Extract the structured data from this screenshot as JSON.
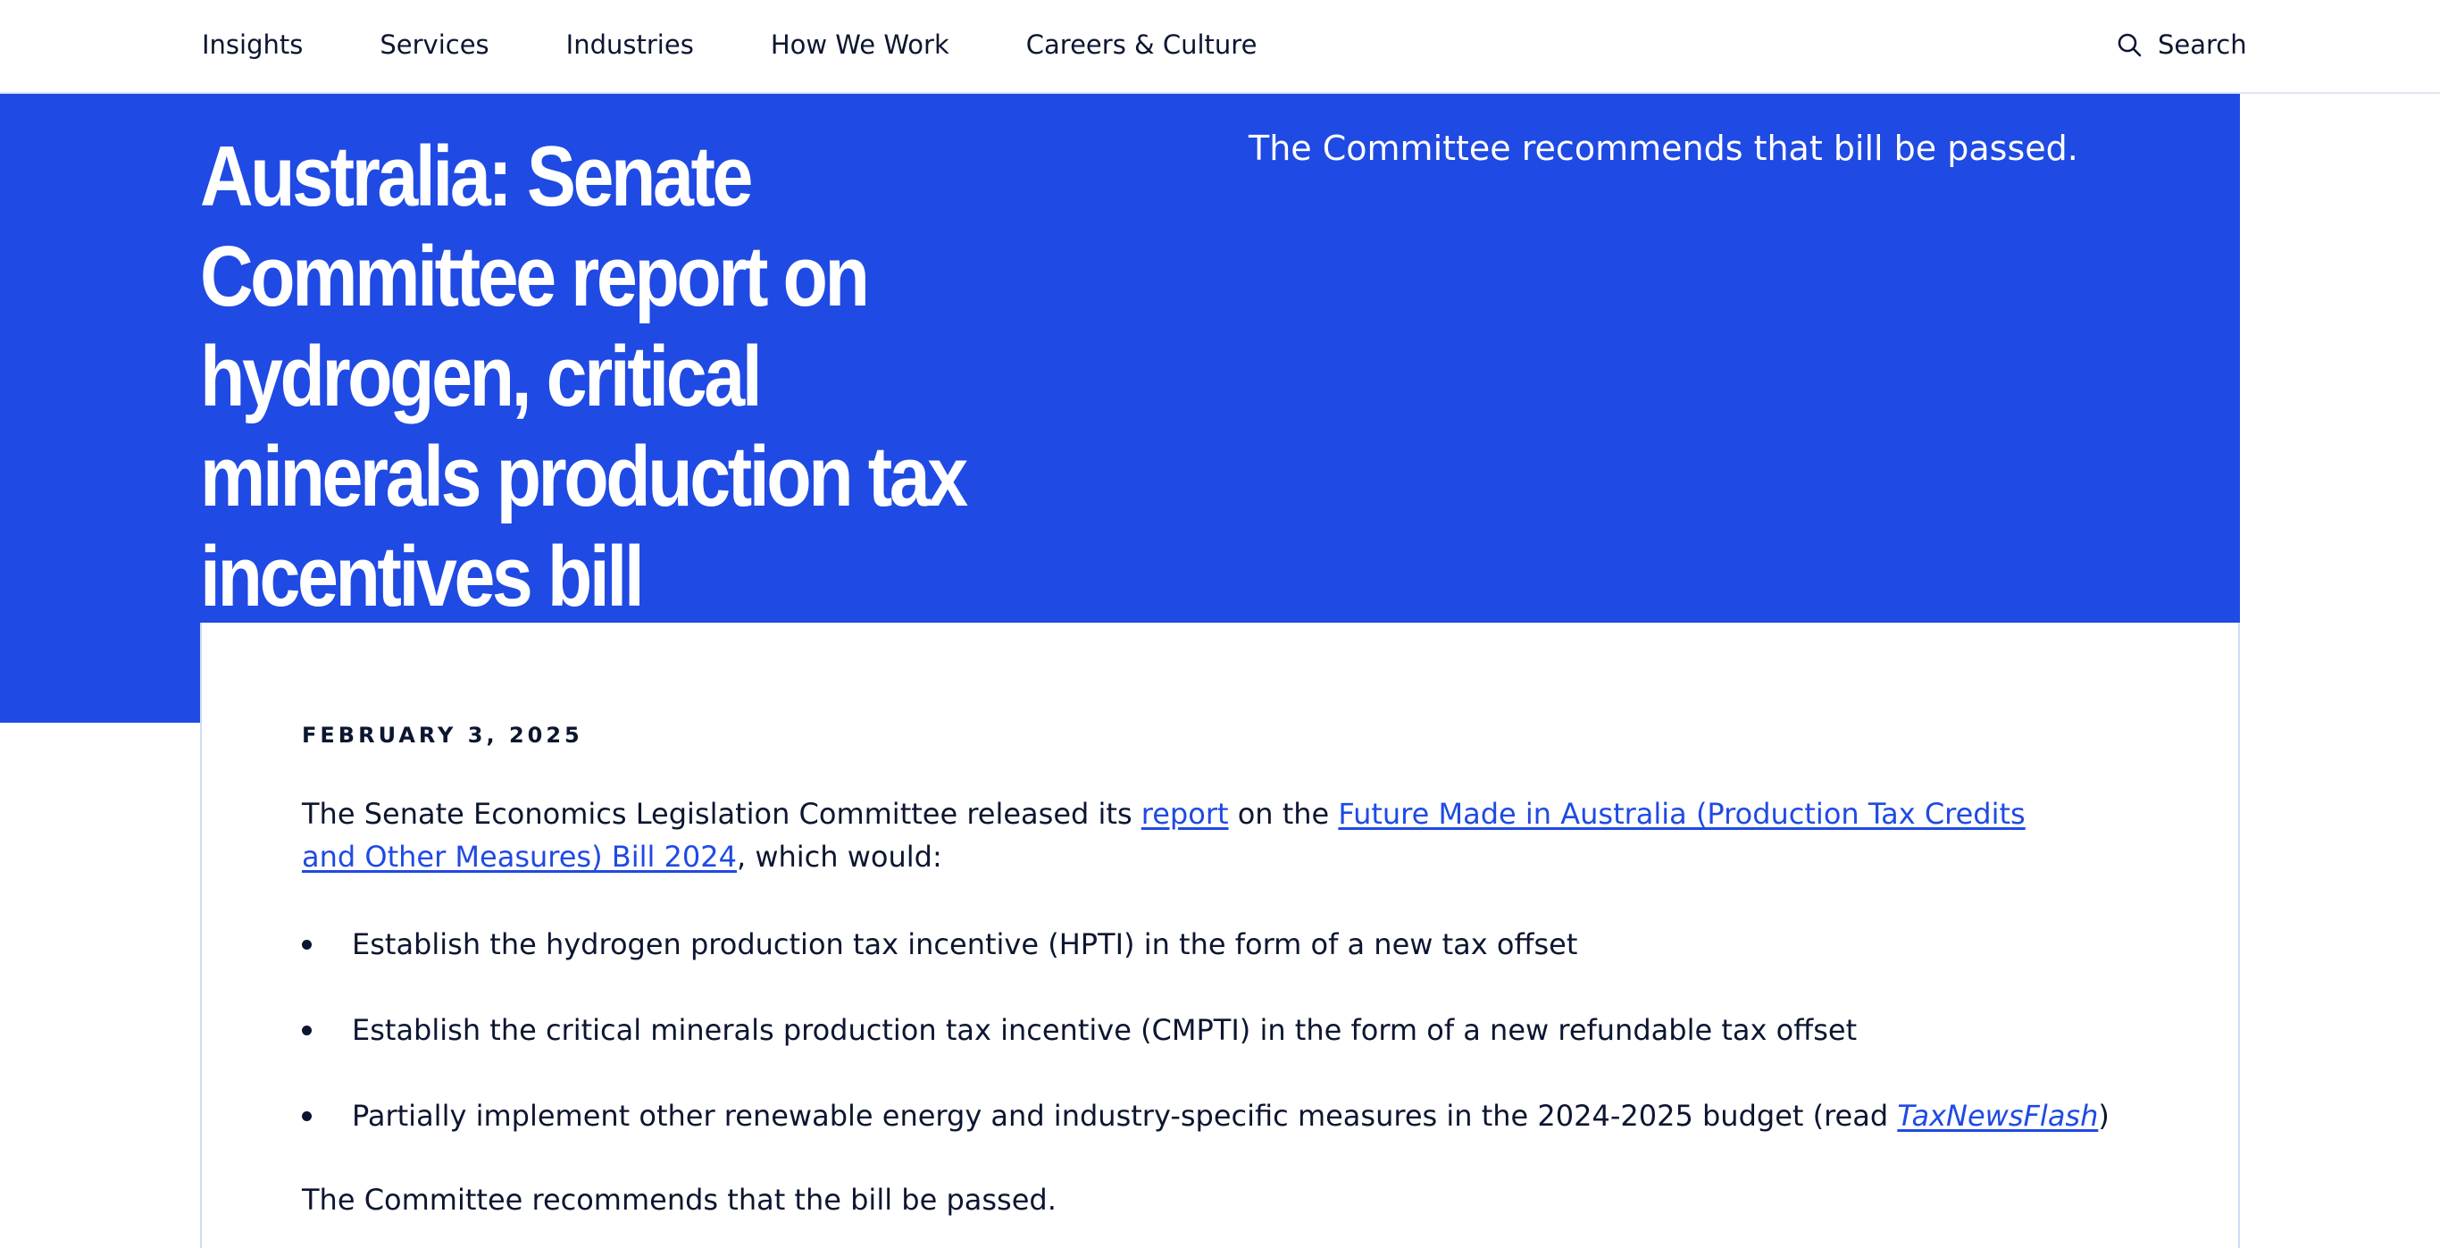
{
  "nav": {
    "items": [
      "Insights",
      "Services",
      "Industries",
      "How We Work",
      "Careers & Culture"
    ],
    "search_label": "Search"
  },
  "hero": {
    "title": "Australia: Senate Committee report on hydrogen, critical minerals production tax incentives bill",
    "summary": "The Committee recommends that bill be passed."
  },
  "article": {
    "date": "FEBRUARY 3, 2025",
    "intro_before": "The Senate Economics Legislation Committee released its ",
    "report_link": "report",
    "intro_middle": " on the ",
    "bill_link": "Future Made in Australia (Production Tax Credits and Other Measures) Bill 2024",
    "intro_after": ", which would:",
    "bullets": [
      "Establish the hydrogen production tax incentive (HPTI) in the form of a new tax offset",
      "Establish the critical minerals production tax incentive (CMPTI) in the form of a new refundable tax offset"
    ],
    "bullet3_before": "Partially implement other renewable energy and industry-specific measures in the 2024-2025 budget (read ",
    "bullet3_link": "TaxNewsFlash",
    "bullet3_after": ")",
    "outro": "The Committee recommends that the bill be passed."
  },
  "colors": {
    "brand_blue": "#1f4ae3",
    "text_dark": "#0c1630",
    "border_light": "#cfdcf7"
  }
}
